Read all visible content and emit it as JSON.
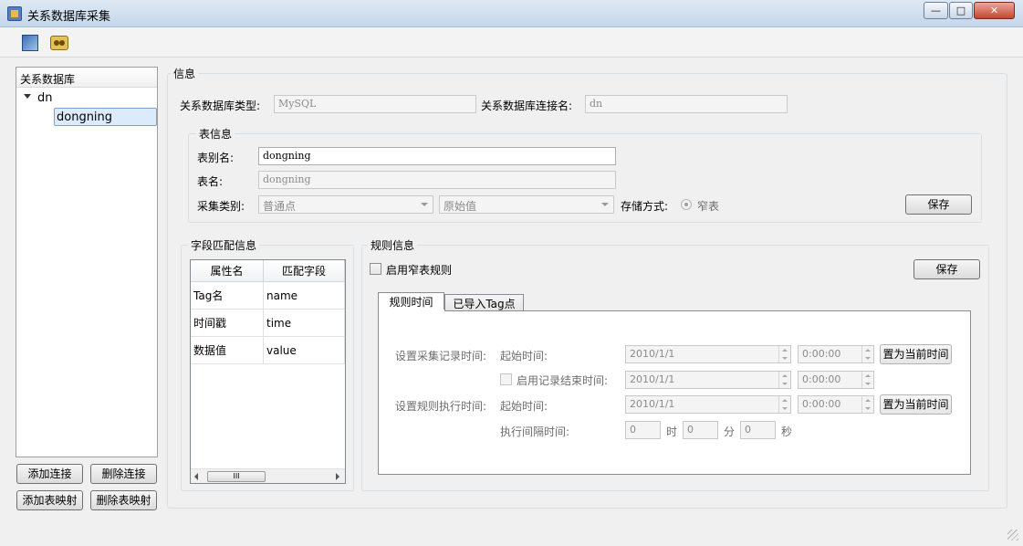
{
  "window": {
    "title": "关系数据库采集",
    "minimize": "—",
    "maximize": "□",
    "close": "✕"
  },
  "toolbar": {
    "icons": [
      "import-icon",
      "connect-icon"
    ]
  },
  "tree": {
    "header": "关系数据库",
    "root": "dn",
    "child": "dongning"
  },
  "left_buttons": {
    "add_connection": "添加连接",
    "delete_connection": "删除连接",
    "add_mapping": "添加表映射",
    "delete_mapping": "删除表映射"
  },
  "info": {
    "group_title": "信息",
    "db_type_label": "关系数据库类型:",
    "db_type_value": "MySQL",
    "conn_name_label": "关系数据库连接名:",
    "conn_name_value": "dn"
  },
  "table_info": {
    "group_title": "表信息",
    "alias_label": "表别名:",
    "alias_value": "dongning",
    "name_label": "表名:",
    "name_value": "dongning",
    "collect_type_label": "采集类别:",
    "collect_type_value": "普通点",
    "value_type": "原始值",
    "storage_label": "存储方式:",
    "storage_value": "窄表",
    "save": "保存"
  },
  "field_match": {
    "group_title": "字段匹配信息",
    "columns": [
      "属性名",
      "匹配字段"
    ],
    "rows": [
      [
        "Tag名",
        "name"
      ],
      [
        "时间戳",
        "time"
      ],
      [
        "数据值",
        "value"
      ]
    ],
    "scroll_grip": "III"
  },
  "rules": {
    "group_title": "规则信息",
    "enable_label": "启用窄表规则",
    "save": "保存",
    "tabs": [
      "规则时间",
      "已导入Tag点"
    ],
    "collect_time_label": "设置采集记录时间:",
    "start_label": "起始时间:",
    "start_date": "2010/1/1",
    "start_time": "0:00:00",
    "set_now": "置为当前时间",
    "enable_end_label": "启用记录结束时间:",
    "end_date": "2010/1/1",
    "end_time": "0:00:00",
    "exec_time_label": "设置规则执行时间:",
    "exec_start_label": "起始时间:",
    "exec_date": "2010/1/1",
    "exec_time": "0:00:00",
    "exec_set_now": "置为当前时间",
    "interval_label": "执行间隔时间:",
    "hours": "0",
    "hours_unit": "时",
    "minutes": "0",
    "minutes_unit": "分",
    "seconds": "0",
    "seconds_unit": "秒"
  }
}
